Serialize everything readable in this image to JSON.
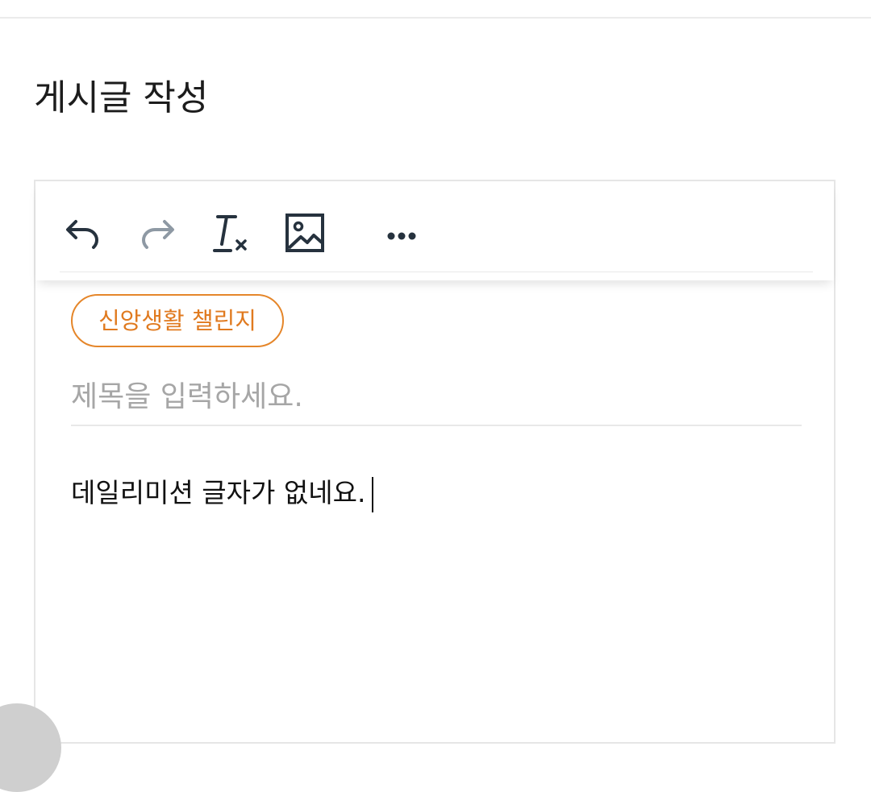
{
  "header": {
    "title": "게시글 작성"
  },
  "toolbar": {
    "buttons": [
      {
        "name": "undo",
        "icon": "undo-icon",
        "enabled": true
      },
      {
        "name": "redo",
        "icon": "redo-icon",
        "enabled": false
      },
      {
        "name": "clear-format",
        "icon": "clear-format-icon",
        "enabled": true
      },
      {
        "name": "insert-image",
        "icon": "image-icon",
        "enabled": true
      },
      {
        "name": "more",
        "icon": "more-horizontal-icon",
        "enabled": true
      }
    ]
  },
  "post": {
    "category": "신앙생활 챌린지",
    "title_value": "",
    "title_placeholder": "제목을 입력하세요.",
    "body": "데일리미션 글자가 없네요."
  },
  "colors": {
    "accent": "#e5862a",
    "icon_active": "#26323e",
    "icon_disabled": "#8e99a4",
    "placeholder": "#a6a6a6"
  }
}
